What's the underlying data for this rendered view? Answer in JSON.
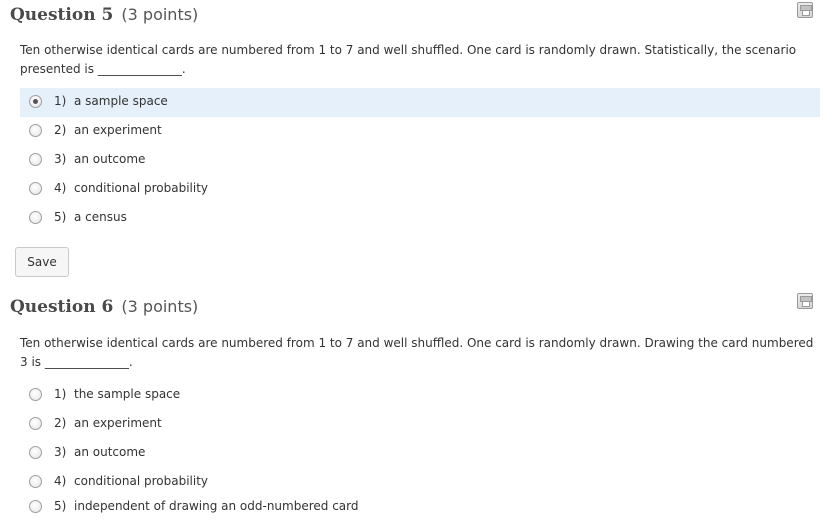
{
  "questions": [
    {
      "title": "Question 5",
      "points": "(3 points)",
      "text": "Ten otherwise identical cards are numbered from 1 to 7 and well shuffled. One card is randomly drawn. Statistically, the scenario presented is ______________.",
      "save_icon": "floppy-disk-icon",
      "options": [
        {
          "num": "1)",
          "label": "a sample space"
        },
        {
          "num": "2)",
          "label": "an experiment"
        },
        {
          "num": "3)",
          "label": "an outcome"
        },
        {
          "num": "4)",
          "label": "conditional probability"
        },
        {
          "num": "5)",
          "label": "a census"
        }
      ],
      "selected_option": 1,
      "save_button": "Save"
    },
    {
      "title": "Question 6",
      "points": "(3 points)",
      "text": "Ten otherwise identical cards are numbered from 1 to 7 and well shuffled. One card is randomly drawn. Drawing the card numbered 3 is ______________.",
      "save_icon": "floppy-disk-icon",
      "options": [
        {
          "num": "1)",
          "label": "the sample space"
        },
        {
          "num": "2)",
          "label": "an experiment"
        },
        {
          "num": "3)",
          "label": "an outcome"
        },
        {
          "num": "4)",
          "label": "conditional probability"
        },
        {
          "num": "5)",
          "label": "independent of drawing an odd-numbered card"
        }
      ],
      "selected_option": null
    }
  ],
  "colors": {
    "selected_row_bg": "#e5f0fb",
    "title_text": "#4a4a4a",
    "body_text": "#333333"
  }
}
